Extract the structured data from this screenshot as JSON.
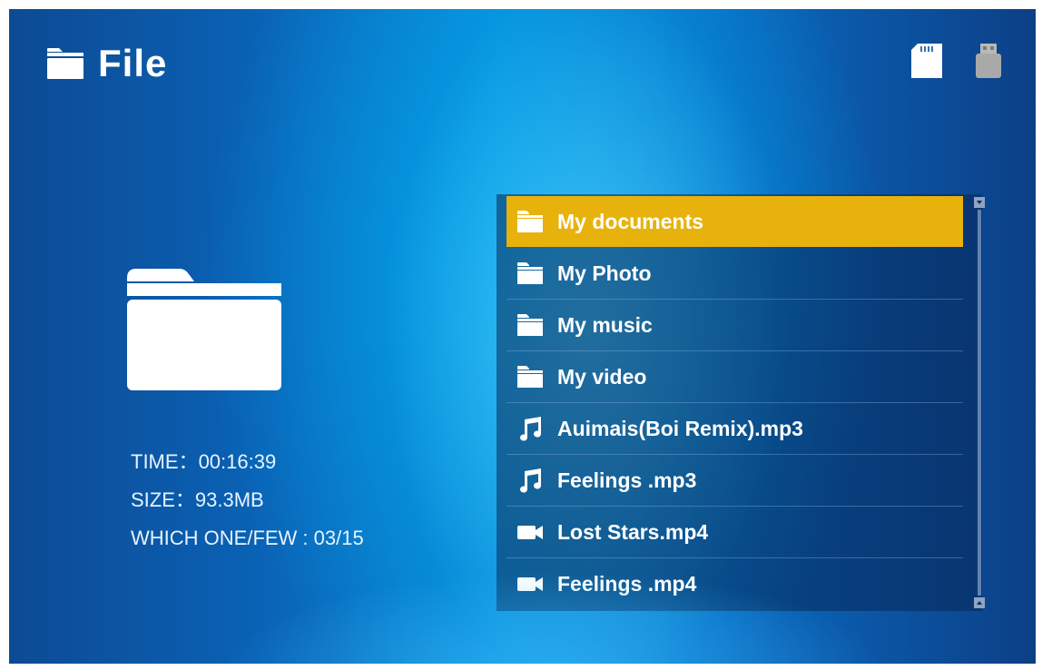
{
  "header": {
    "title": "File",
    "title_icon": "folder-icon",
    "storage_icons": [
      "sd-card-icon",
      "usb-drive-icon"
    ]
  },
  "preview": {
    "icon": "folder-icon",
    "time_label": "TIME：",
    "time_value": "00:16:39",
    "size_label": "SIZE：",
    "size_value": "93.3MB",
    "position_label": "WHICH ONE/FEW : ",
    "position_value": "03/15"
  },
  "file_list": {
    "items": [
      {
        "label": "My documents",
        "icon": "folder-icon",
        "selected": true
      },
      {
        "label": "My Photo",
        "icon": "folder-icon"
      },
      {
        "label": "My music",
        "icon": "folder-icon"
      },
      {
        "label": "My video",
        "icon": "folder-icon"
      },
      {
        "label": "Auimais(Boi Remix).mp3",
        "icon": "music-note-icon"
      },
      {
        "label": "Feelings .mp3",
        "icon": "music-note-icon"
      },
      {
        "label": "Lost Stars.mp4",
        "icon": "video-camera-icon"
      },
      {
        "label": "Feelings .mp4",
        "icon": "video-camera-icon"
      }
    ]
  },
  "colors": {
    "selected_highlight": "#e8b20c",
    "background_blue": "#0a6ac0",
    "text": "#ffffff"
  }
}
